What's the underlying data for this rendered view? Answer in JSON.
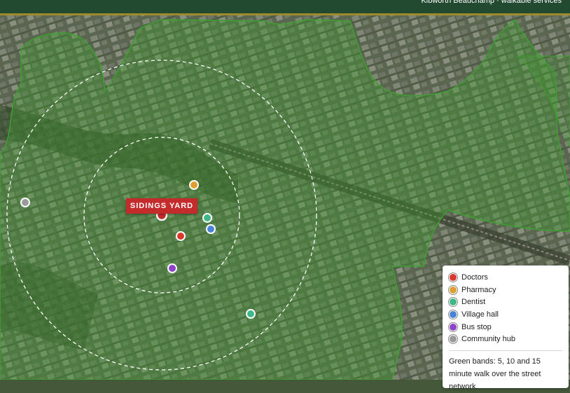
{
  "header": {
    "title": "Kibworth Beauchamp · walkable services"
  },
  "site": {
    "label": "SIDINGS YARD"
  },
  "legend": {
    "items": [
      {
        "label": "Doctors",
        "color": "#d8392c",
        "icon": "doctors-marker"
      },
      {
        "label": "Pharmacy",
        "color": "#e0a030",
        "icon": "pharmacy-marker"
      },
      {
        "label": "Dentist",
        "color": "#3fb888",
        "icon": "dentist-marker"
      },
      {
        "label": "Village hall",
        "color": "#4a82d8",
        "icon": "village-hall-marker"
      },
      {
        "label": "Bus stop",
        "color": "#8e44c8",
        "icon": "bus-stop-marker"
      },
      {
        "label": "Community hub",
        "color": "#9a9a9a",
        "icon": "community-hub-marker"
      }
    ],
    "note": "Green bands: 5, 10 and 15 minute walk over the street network."
  },
  "colors": {
    "header_bg": "#224a30",
    "header_border": "#a08a2e",
    "walk_band": "#3f9a2e",
    "site_marker": "#c42c2c"
  }
}
